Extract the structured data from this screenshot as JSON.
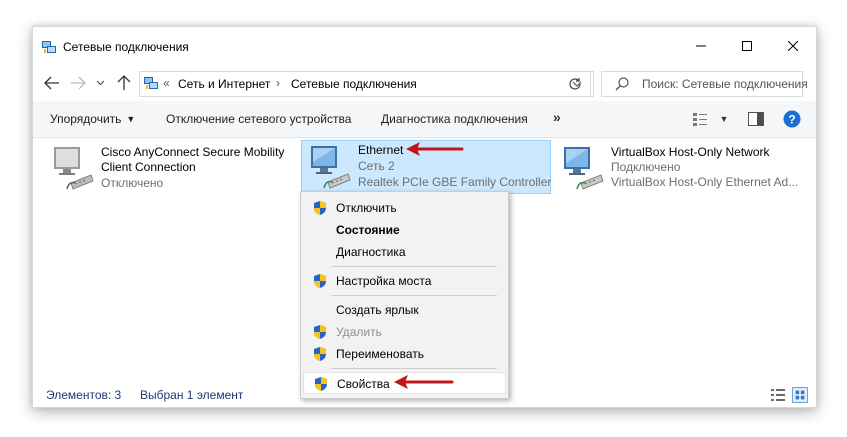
{
  "window": {
    "title": "Сетевые подключения",
    "controls": {
      "minimize": "minimize-icon",
      "maximize": "maximize-icon",
      "close": "close-icon"
    }
  },
  "address": {
    "crumbs": [
      "Сеть и Интернет",
      "Сетевые подключения"
    ],
    "search_placeholder": "Поиск: Сетевые подключения"
  },
  "commands": {
    "organize": "Упорядочить",
    "disable_device": "Отключение сетевого устройства",
    "diagnose": "Диагностика подключения",
    "more": "»"
  },
  "items": [
    {
      "name_line1": "Cisco AnyConnect Secure Mobility",
      "name_line2": "Client Connection",
      "status": "Отключено",
      "selected": false
    },
    {
      "name": "Ethernet",
      "network": "Сеть  2",
      "adapter": "Realtek PCIe GBE Family Controller",
      "selected": true
    },
    {
      "name": "VirtualBox Host-Only Network",
      "status": "Подключено",
      "adapter": "VirtualBox Host-Only Ethernet Ad...",
      "selected": false
    }
  ],
  "context_menu": [
    {
      "label": "Отключить",
      "icon": "shield-icon",
      "bold": false,
      "disabled": false
    },
    {
      "label": "Состояние",
      "icon": "",
      "bold": true,
      "disabled": false
    },
    {
      "label": "Диагностика",
      "icon": "",
      "bold": false,
      "disabled": false
    },
    {
      "label": "Настройка моста",
      "icon": "shield-icon",
      "bold": false,
      "disabled": false
    },
    {
      "label": "Создать ярлык",
      "icon": "",
      "bold": false,
      "disabled": false
    },
    {
      "label": "Удалить",
      "icon": "shield-icon",
      "bold": false,
      "disabled": true
    },
    {
      "label": "Переименовать",
      "icon": "shield-icon",
      "bold": false,
      "disabled": false
    },
    {
      "label": "Свойства",
      "icon": "shield-icon",
      "bold": false,
      "disabled": false
    }
  ],
  "status": {
    "count": "Элементов: 3",
    "selection": "Выбран 1 элемент"
  },
  "colors": {
    "selection_bg": "#cce8ff",
    "selection_border": "#99d1ff",
    "arrow": "#c0151a",
    "help": "#1a6fd1"
  }
}
